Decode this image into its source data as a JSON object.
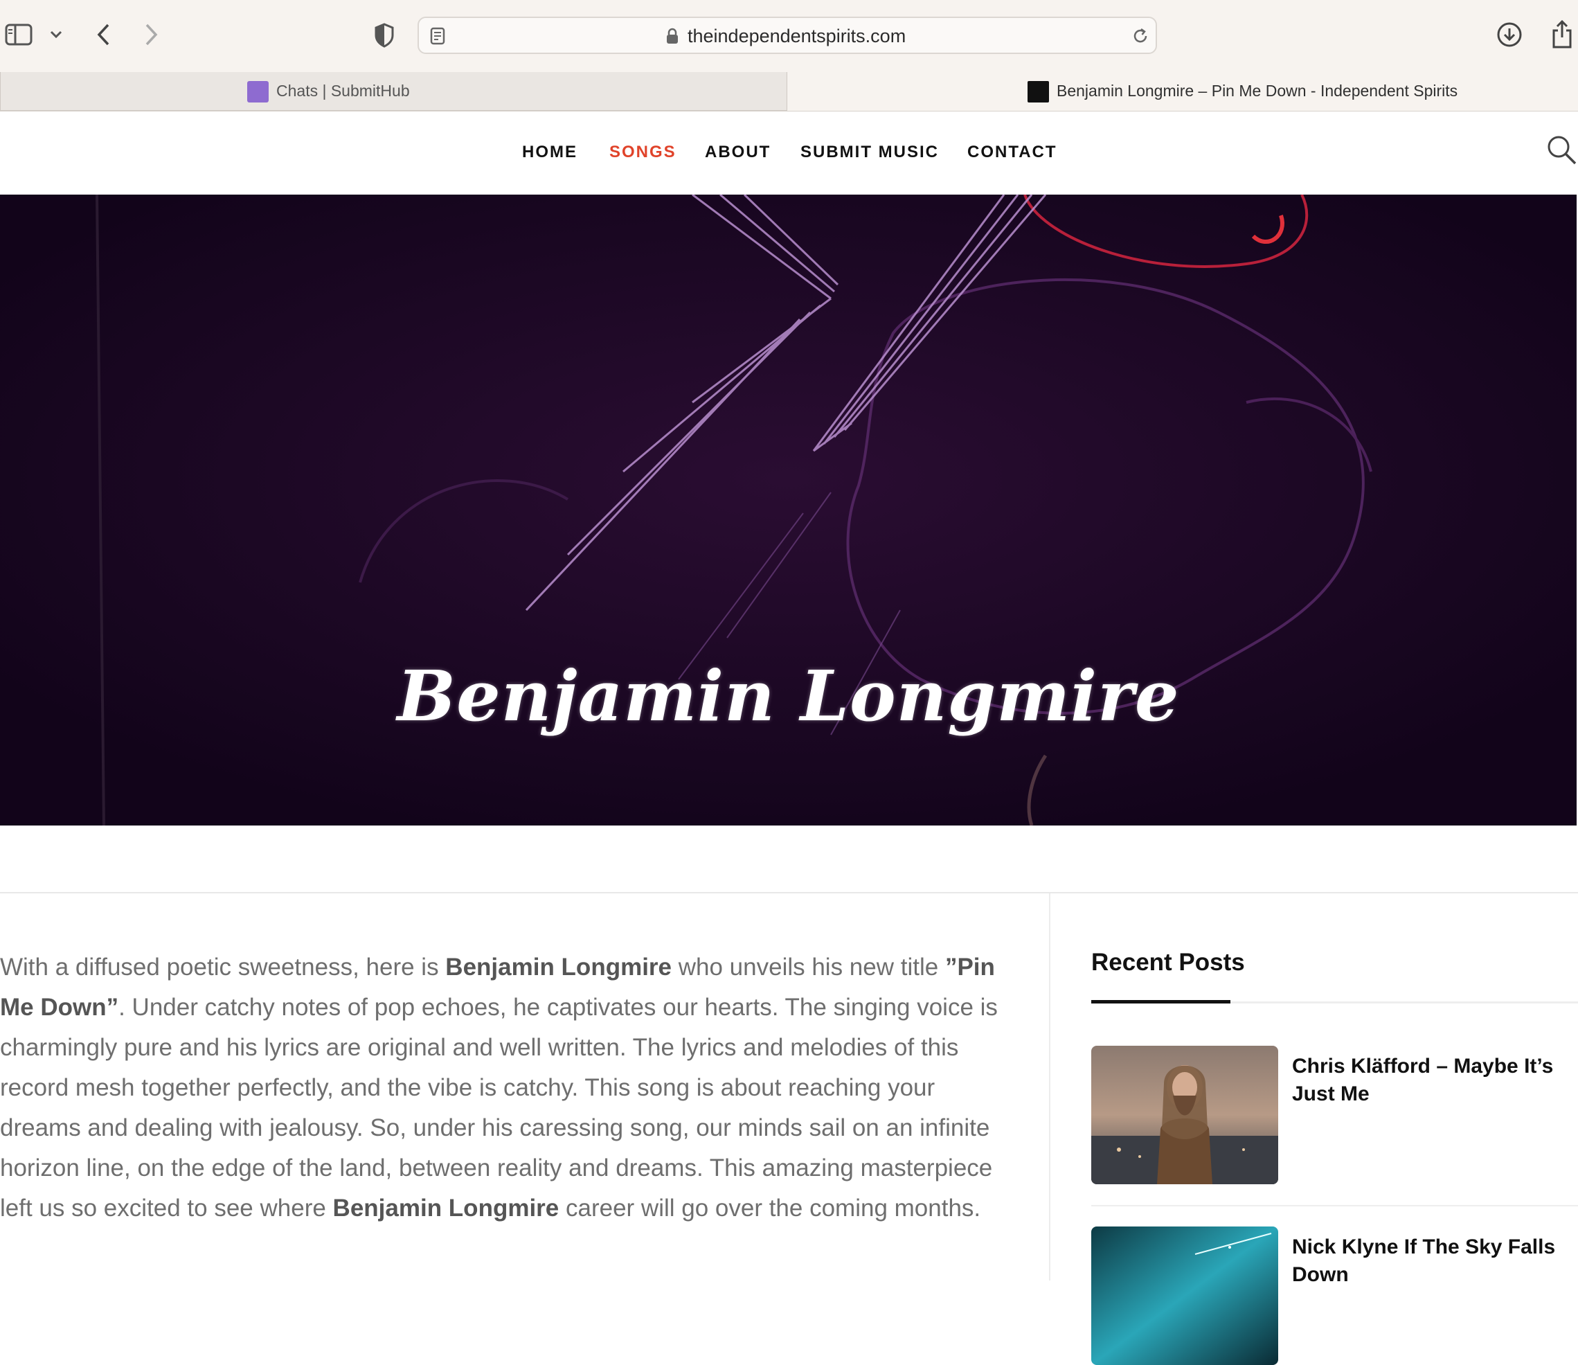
{
  "browser": {
    "url": "theindependentspirits.com",
    "tabs": [
      {
        "title": "Chats | SubmitHub",
        "active": false,
        "favicon_color": "#8e6bd0"
      },
      {
        "title": "Benjamin Longmire – Pin Me Down - Independent Spirits",
        "active": true,
        "favicon_color": "#111111"
      }
    ],
    "icons": [
      "sidebar-icon",
      "chevron-down-icon",
      "back-icon",
      "forward-icon",
      "privacy-shield-icon",
      "reader-icon",
      "lock-icon",
      "reload-icon",
      "download-icon",
      "share-icon"
    ]
  },
  "nav": {
    "items": [
      {
        "label": "HOME",
        "active": false
      },
      {
        "label": "SONGS",
        "active": true
      },
      {
        "label": "ABOUT",
        "active": false
      },
      {
        "label": "SUBMIT MUSIC",
        "active": false
      },
      {
        "label": "CONTACT",
        "active": false
      }
    ],
    "search_icon": "search-icon",
    "active_color": "#e0432a"
  },
  "hero": {
    "title": "Benjamin Longmire",
    "background": "#16061f"
  },
  "article": {
    "p1_a": "With a diffused poetic sweetness, here is ",
    "artist": "Benjamin Longmire",
    "p1_b": " who unveils his new title ",
    "song": "”Pin Me Down”",
    "p1_c": ". Under catchy notes of pop echoes, he captivates our hearts. The singing voice is charmingly pure and his lyrics are original and well written. The lyrics and melodies of this record mesh together perfectly, and the vibe is catchy. This song is about reaching your dreams and dealing with jealousy. So, under his caressing song, our minds sail on an infinite horizon line, on the edge of the land, between reality and dreams. This amazing masterpiece left us so excited to see where ",
    "artist2": "Benjamin Longmire",
    "p1_d": " career will go over the coming months."
  },
  "sidebar": {
    "heading": "Recent Posts",
    "posts": [
      {
        "title": "Chris Kläfford – Maybe It’s Just Me"
      },
      {
        "title": "Nick Klyne If The Sky Falls Down"
      }
    ]
  }
}
